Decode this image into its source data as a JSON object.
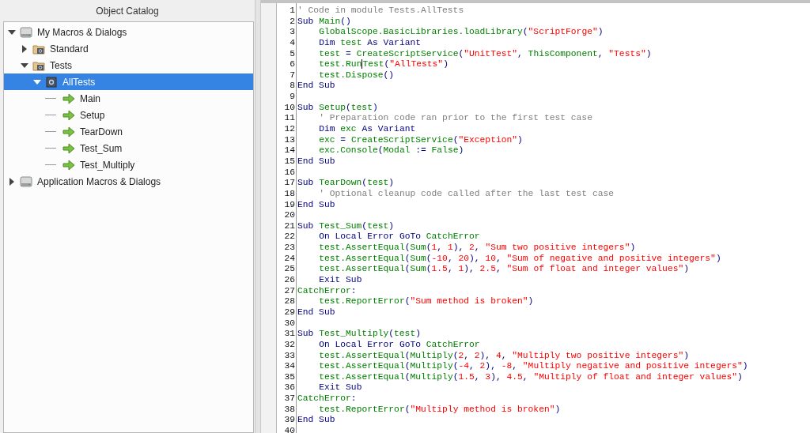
{
  "panel_title": "Object Catalog",
  "tree": [
    {
      "label": "My Macros & Dialogs",
      "kind": "container",
      "expanded": true,
      "selected": false,
      "children": [
        {
          "label": "Standard",
          "kind": "library",
          "expanded": false,
          "selected": false
        },
        {
          "label": "Tests",
          "kind": "library",
          "expanded": true,
          "selected": false,
          "children": [
            {
              "label": "AllTests",
              "kind": "module",
              "expanded": true,
              "selected": true,
              "children": [
                {
                  "label": "Main",
                  "kind": "method",
                  "selected": false
                },
                {
                  "label": "Setup",
                  "kind": "method",
                  "selected": false
                },
                {
                  "label": "TearDown",
                  "kind": "method",
                  "selected": false
                },
                {
                  "label": "Test_Sum",
                  "kind": "method",
                  "selected": false
                },
                {
                  "label": "Test_Multiply",
                  "kind": "method",
                  "selected": false
                }
              ]
            }
          ]
        }
      ]
    },
    {
      "label": "Application Macros & Dialogs",
      "kind": "container",
      "expanded": false,
      "selected": false
    }
  ],
  "code_lines": [
    {
      "number": "1",
      "indented": false,
      "tokens": [
        {
          "kind": "comment",
          "text": "' Code in module Tests.AllTests"
        }
      ]
    },
    {
      "number": "2",
      "indented": false,
      "tokens": [
        {
          "kind": "keyword",
          "text": "Sub "
        },
        {
          "kind": "name",
          "text": "Main"
        },
        {
          "kind": "symbol",
          "text": "()"
        }
      ]
    },
    {
      "number": "3",
      "indented": true,
      "tokens": [
        {
          "kind": "name",
          "text": "GlobalScope.BasicLibraries.loadLibrary"
        },
        {
          "kind": "symbol",
          "text": "("
        },
        {
          "kind": "string",
          "text": "\"ScriptForge\""
        },
        {
          "kind": "symbol",
          "text": ")"
        }
      ]
    },
    {
      "number": "4",
      "indented": true,
      "tokens": [
        {
          "kind": "keyword",
          "text": "Dim "
        },
        {
          "kind": "name",
          "text": "test"
        },
        {
          "kind": "keyword",
          "text": " As Variant"
        }
      ]
    },
    {
      "number": "5",
      "indented": true,
      "tokens": [
        {
          "kind": "name",
          "text": "test"
        },
        {
          "kind": "symbol",
          "text": " = "
        },
        {
          "kind": "name",
          "text": "CreateScriptService"
        },
        {
          "kind": "symbol",
          "text": "("
        },
        {
          "kind": "string",
          "text": "\"UnitTest\""
        },
        {
          "kind": "symbol",
          "text": ", "
        },
        {
          "kind": "name",
          "text": "ThisComponent"
        },
        {
          "kind": "symbol",
          "text": ", "
        },
        {
          "kind": "string",
          "text": "\"Tests\""
        },
        {
          "kind": "symbol",
          "text": ")"
        }
      ]
    },
    {
      "number": "6",
      "indented": true,
      "tokens": [
        {
          "kind": "name",
          "text": "test.Run"
        },
        {
          "kind": "name",
          "text": "Test",
          "caret_before": true
        },
        {
          "kind": "symbol",
          "text": "("
        },
        {
          "kind": "string",
          "text": "\"AllTests\""
        },
        {
          "kind": "symbol",
          "text": ")"
        }
      ]
    },
    {
      "number": "7",
      "indented": true,
      "tokens": [
        {
          "kind": "name",
          "text": "test.Dispose"
        },
        {
          "kind": "symbol",
          "text": "()"
        }
      ]
    },
    {
      "number": "8",
      "indented": false,
      "tokens": [
        {
          "kind": "keyword",
          "text": "End Sub"
        }
      ]
    },
    {
      "number": "9"
    },
    {
      "number": "10",
      "indented": false,
      "tokens": [
        {
          "kind": "keyword",
          "text": "Sub "
        },
        {
          "kind": "name",
          "text": "Setup"
        },
        {
          "kind": "symbol",
          "text": "("
        },
        {
          "kind": "name",
          "text": "test"
        },
        {
          "kind": "symbol",
          "text": ")"
        }
      ]
    },
    {
      "number": "11",
      "indented": true,
      "tokens": [
        {
          "kind": "comment",
          "text": "' Preparation code ran prior to the first test case"
        }
      ]
    },
    {
      "number": "12",
      "indented": true,
      "tokens": [
        {
          "kind": "keyword",
          "text": "Dim "
        },
        {
          "kind": "name",
          "text": "exc"
        },
        {
          "kind": "keyword",
          "text": " As Variant"
        }
      ]
    },
    {
      "number": "13",
      "indented": true,
      "tokens": [
        {
          "kind": "name",
          "text": "exc"
        },
        {
          "kind": "symbol",
          "text": " = "
        },
        {
          "kind": "name",
          "text": "CreateScriptService"
        },
        {
          "kind": "symbol",
          "text": "("
        },
        {
          "kind": "string",
          "text": "\"Exception\""
        },
        {
          "kind": "symbol",
          "text": ")"
        }
      ]
    },
    {
      "number": "14",
      "indented": true,
      "tokens": [
        {
          "kind": "name",
          "text": "exc.Console"
        },
        {
          "kind": "symbol",
          "text": "("
        },
        {
          "kind": "name",
          "text": "Modal"
        },
        {
          "kind": "symbol",
          "text": " := "
        },
        {
          "kind": "name",
          "text": "False"
        },
        {
          "kind": "symbol",
          "text": ")"
        }
      ]
    },
    {
      "number": "15",
      "indented": false,
      "tokens": [
        {
          "kind": "keyword",
          "text": "End Sub"
        }
      ]
    },
    {
      "number": "16"
    },
    {
      "number": "17",
      "indented": false,
      "tokens": [
        {
          "kind": "keyword",
          "text": "Sub "
        },
        {
          "kind": "name",
          "text": "TearDown"
        },
        {
          "kind": "symbol",
          "text": "("
        },
        {
          "kind": "name",
          "text": "test"
        },
        {
          "kind": "symbol",
          "text": ")"
        }
      ]
    },
    {
      "number": "18",
      "indented": true,
      "tokens": [
        {
          "kind": "comment",
          "text": "' Optional cleanup code called after the last test case"
        }
      ]
    },
    {
      "number": "19",
      "indented": false,
      "tokens": [
        {
          "kind": "keyword",
          "text": "End Sub"
        }
      ]
    },
    {
      "number": "20"
    },
    {
      "number": "21",
      "indented": false,
      "tokens": [
        {
          "kind": "keyword",
          "text": "Sub "
        },
        {
          "kind": "name",
          "text": "Test_Sum"
        },
        {
          "kind": "symbol",
          "text": "("
        },
        {
          "kind": "name",
          "text": "test"
        },
        {
          "kind": "symbol",
          "text": ")"
        }
      ]
    },
    {
      "number": "22",
      "indented": true,
      "tokens": [
        {
          "kind": "keyword",
          "text": "On Local Error GoTo "
        },
        {
          "kind": "name",
          "text": "CatchError"
        }
      ]
    },
    {
      "number": "23",
      "indented": true,
      "tokens": [
        {
          "kind": "name",
          "text": "test.AssertEqual"
        },
        {
          "kind": "symbol",
          "text": "("
        },
        {
          "kind": "name",
          "text": "Sum"
        },
        {
          "kind": "symbol",
          "text": "("
        },
        {
          "kind": "number",
          "text": "1"
        },
        {
          "kind": "symbol",
          "text": ", "
        },
        {
          "kind": "number",
          "text": "1"
        },
        {
          "kind": "symbol",
          "text": "), "
        },
        {
          "kind": "number",
          "text": "2"
        },
        {
          "kind": "symbol",
          "text": ", "
        },
        {
          "kind": "string",
          "text": "\"Sum two positive integers\""
        },
        {
          "kind": "symbol",
          "text": ")"
        }
      ]
    },
    {
      "number": "24",
      "indented": true,
      "tokens": [
        {
          "kind": "name",
          "text": "test.AssertEqual"
        },
        {
          "kind": "symbol",
          "text": "("
        },
        {
          "kind": "name",
          "text": "Sum"
        },
        {
          "kind": "symbol",
          "text": "("
        },
        {
          "kind": "number",
          "text": "-10"
        },
        {
          "kind": "symbol",
          "text": ", "
        },
        {
          "kind": "number",
          "text": "20"
        },
        {
          "kind": "symbol",
          "text": "), "
        },
        {
          "kind": "number",
          "text": "10"
        },
        {
          "kind": "symbol",
          "text": ", "
        },
        {
          "kind": "string",
          "text": "\"Sum of negative and positive integers\""
        },
        {
          "kind": "symbol",
          "text": ")"
        }
      ]
    },
    {
      "number": "25",
      "indented": true,
      "tokens": [
        {
          "kind": "name",
          "text": "test.AssertEqual"
        },
        {
          "kind": "symbol",
          "text": "("
        },
        {
          "kind": "name",
          "text": "Sum"
        },
        {
          "kind": "symbol",
          "text": "("
        },
        {
          "kind": "number",
          "text": "1.5"
        },
        {
          "kind": "symbol",
          "text": ", "
        },
        {
          "kind": "number",
          "text": "1"
        },
        {
          "kind": "symbol",
          "text": "), "
        },
        {
          "kind": "number",
          "text": "2.5"
        },
        {
          "kind": "symbol",
          "text": ", "
        },
        {
          "kind": "string",
          "text": "\"Sum of float and integer values\""
        },
        {
          "kind": "symbol",
          "text": ")"
        }
      ]
    },
    {
      "number": "26",
      "indented": true,
      "tokens": [
        {
          "kind": "keyword",
          "text": "Exit Sub"
        }
      ]
    },
    {
      "number": "27",
      "indented": false,
      "tokens": [
        {
          "kind": "name",
          "text": "CatchError"
        },
        {
          "kind": "symbol",
          "text": ":"
        }
      ]
    },
    {
      "number": "28",
      "indented": true,
      "tokens": [
        {
          "kind": "name",
          "text": "test.ReportError"
        },
        {
          "kind": "symbol",
          "text": "("
        },
        {
          "kind": "string",
          "text": "\"Sum method is broken\""
        },
        {
          "kind": "symbol",
          "text": ")"
        }
      ]
    },
    {
      "number": "29",
      "indented": false,
      "tokens": [
        {
          "kind": "keyword",
          "text": "End Sub"
        }
      ]
    },
    {
      "number": "30"
    },
    {
      "number": "31",
      "indented": false,
      "tokens": [
        {
          "kind": "keyword",
          "text": "Sub "
        },
        {
          "kind": "name",
          "text": "Test_Multiply"
        },
        {
          "kind": "symbol",
          "text": "("
        },
        {
          "kind": "name",
          "text": "test"
        },
        {
          "kind": "symbol",
          "text": ")"
        }
      ]
    },
    {
      "number": "32",
      "indented": true,
      "tokens": [
        {
          "kind": "keyword",
          "text": "On Local Error GoTo "
        },
        {
          "kind": "name",
          "text": "CatchError"
        }
      ]
    },
    {
      "number": "33",
      "indented": true,
      "tokens": [
        {
          "kind": "name",
          "text": "test.AssertEqual"
        },
        {
          "kind": "symbol",
          "text": "("
        },
        {
          "kind": "name",
          "text": "Multiply"
        },
        {
          "kind": "symbol",
          "text": "("
        },
        {
          "kind": "number",
          "text": "2"
        },
        {
          "kind": "symbol",
          "text": ", "
        },
        {
          "kind": "number",
          "text": "2"
        },
        {
          "kind": "symbol",
          "text": "), "
        },
        {
          "kind": "number",
          "text": "4"
        },
        {
          "kind": "symbol",
          "text": ", "
        },
        {
          "kind": "string",
          "text": "\"Multiply two positive integers\""
        },
        {
          "kind": "symbol",
          "text": ")"
        }
      ]
    },
    {
      "number": "34",
      "indented": true,
      "tokens": [
        {
          "kind": "name",
          "text": "test.AssertEqual"
        },
        {
          "kind": "symbol",
          "text": "("
        },
        {
          "kind": "name",
          "text": "Multiply"
        },
        {
          "kind": "symbol",
          "text": "("
        },
        {
          "kind": "number",
          "text": "-4"
        },
        {
          "kind": "symbol",
          "text": ", "
        },
        {
          "kind": "number",
          "text": "2"
        },
        {
          "kind": "symbol",
          "text": "), "
        },
        {
          "kind": "number",
          "text": "-8"
        },
        {
          "kind": "symbol",
          "text": ", "
        },
        {
          "kind": "string",
          "text": "\"Multiply negative and positive integers\""
        },
        {
          "kind": "symbol",
          "text": ")"
        }
      ]
    },
    {
      "number": "35",
      "indented": true,
      "tokens": [
        {
          "kind": "name",
          "text": "test.AssertEqual"
        },
        {
          "kind": "symbol",
          "text": "("
        },
        {
          "kind": "name",
          "text": "Multiply"
        },
        {
          "kind": "symbol",
          "text": "("
        },
        {
          "kind": "number",
          "text": "1.5"
        },
        {
          "kind": "symbol",
          "text": ", "
        },
        {
          "kind": "number",
          "text": "3"
        },
        {
          "kind": "symbol",
          "text": "), "
        },
        {
          "kind": "number",
          "text": "4.5"
        },
        {
          "kind": "symbol",
          "text": ", "
        },
        {
          "kind": "string",
          "text": "\"Multiply of float and integer values\""
        },
        {
          "kind": "symbol",
          "text": ")"
        }
      ]
    },
    {
      "number": "36",
      "indented": true,
      "tokens": [
        {
          "kind": "keyword",
          "text": "Exit Sub"
        }
      ]
    },
    {
      "number": "37",
      "indented": false,
      "tokens": [
        {
          "kind": "name",
          "text": "CatchError"
        },
        {
          "kind": "symbol",
          "text": ":"
        }
      ]
    },
    {
      "number": "38",
      "indented": true,
      "tokens": [
        {
          "kind": "name",
          "text": "test.ReportError"
        },
        {
          "kind": "symbol",
          "text": "("
        },
        {
          "kind": "string",
          "text": "\"Multiply method is broken\""
        },
        {
          "kind": "symbol",
          "text": ")"
        }
      ]
    },
    {
      "number": "39",
      "indented": false,
      "tokens": [
        {
          "kind": "keyword",
          "text": "End Sub"
        }
      ]
    },
    {
      "number": "40"
    }
  ]
}
